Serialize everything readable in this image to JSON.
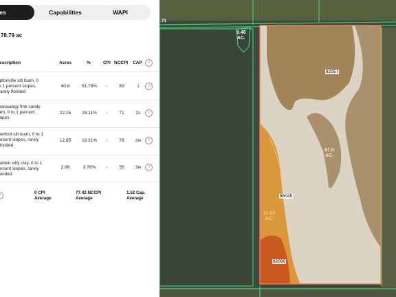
{
  "tabs": {
    "acres": "res",
    "capabilities": "Capabilities",
    "wapi": "WAPI"
  },
  "total": "78.79 ac",
  "table": {
    "headers": [
      "escription",
      "Acres",
      "%",
      "CPI",
      "NCCPI",
      "CAP"
    ],
    "help_glyph": "?",
    "rows": [
      {
        "desc": [
          "iptonville silt loam, 0",
          "o 1 percent slopes,",
          "rarely flooded"
        ],
        "acres": "40.8",
        "pct": "51.78%",
        "cpi": "-",
        "nccpi": "83",
        "cap": "1"
      },
      {
        "desc": [
          "owosahgy fine sandy",
          "am, 0 to 1 percent",
          "lopes"
        ],
        "acres": "22.15",
        "pct": "28.11%",
        "cpi": "-",
        "nccpi": "71",
        "cap": "2s"
      },
      {
        "desc": [
          "eelfoot silt loam, 0 to 1",
          "ercent slopes, rarely",
          "flooded"
        ],
        "acres": "12.85",
        "pct": "16.31%",
        "cpi": "-",
        "nccpi": "76",
        "cap": "2w"
      },
      {
        "desc": [
          "oellen silty clay, 0 to 1",
          "ercent slopes, rarely",
          "looded"
        ],
        "acres": "2.98",
        "pct": "3.78%",
        "cpi": "-",
        "nccpi": "55",
        "cap": "3w"
      }
    ],
    "averages": {
      "cpi": [
        "0 CPI",
        "Average"
      ],
      "nccpi": [
        "77.42 NCCPI",
        "Average"
      ],
      "cap": [
        "1.52 Cap.",
        "Average"
      ]
    }
  },
  "map": {
    "edge_label": ".71",
    "small_ac": [
      "0.46",
      "AC."
    ],
    "big_ac": [
      "67.6",
      "AC."
    ],
    "mid_ac": [
      "11.23",
      "AC."
    ],
    "soil_codes": [
      "82057",
      "86045",
      "82090"
    ],
    "colors": {
      "light_soil": "#e8e0cf",
      "brown_soil": "#9b7b4e",
      "orange_soil": "#d9912c",
      "red_soil": "#c9561f",
      "boundary": "#ff7a5a",
      "field_line": "#3bd16e"
    }
  }
}
